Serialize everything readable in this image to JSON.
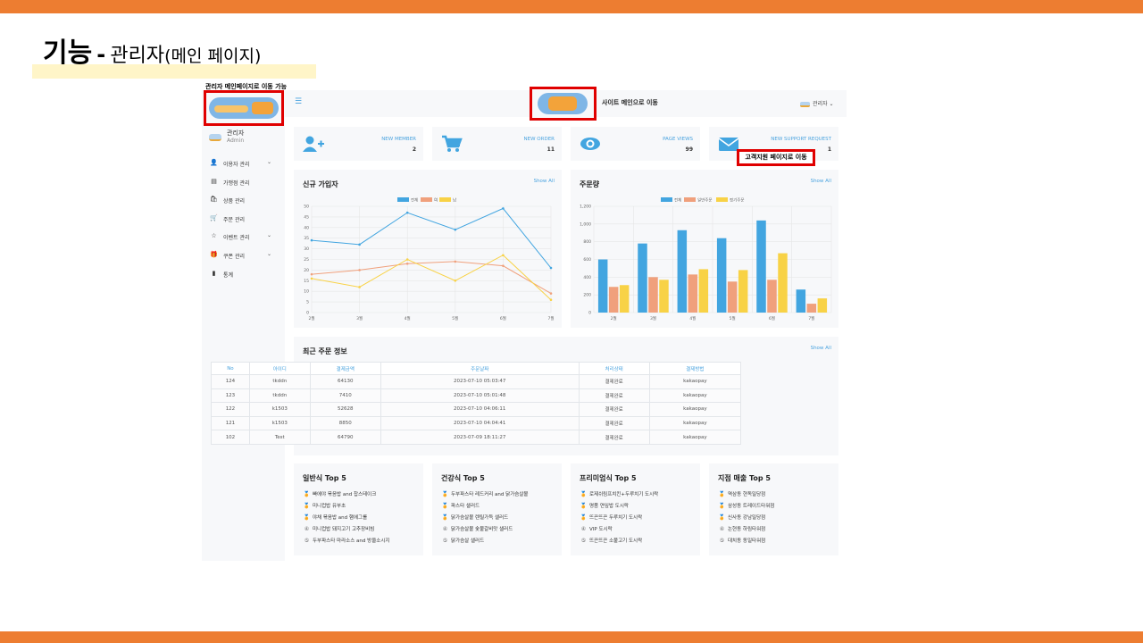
{
  "slide": {
    "title_main": "기능",
    "title_dash": "-",
    "title_sub": "관리자",
    "title_paren": "(메인 페이지)",
    "note": "관리자 메인페이지로 이동 가능",
    "support_label": "고객지원 페이지로 이동",
    "colors": {
      "accent_bar": "#ED7D31",
      "highlight": "#FFF5C8",
      "callout": "#E00000",
      "link": "#4AA3DF"
    }
  },
  "topbar": {
    "menu_icon": "hamburger-icon",
    "site_link": "사이트 메인으로 이동",
    "admin_label": "관리자"
  },
  "sidebar": {
    "profile_name": "관리자",
    "profile_role": "Admin",
    "items": [
      {
        "label": "이용자 관리",
        "icon": "user-icon",
        "glyph": "👤",
        "chevron": "⌄"
      },
      {
        "label": "가맹점 관리",
        "icon": "store-icon",
        "glyph": "▤",
        "chevron": ""
      },
      {
        "label": "상품 관리",
        "icon": "bag-icon",
        "glyph": "🛍",
        "chevron": ""
      },
      {
        "label": "주문 관리",
        "icon": "cart-icon",
        "glyph": "🛒",
        "chevron": ""
      },
      {
        "label": "이벤트 관리",
        "icon": "star-icon",
        "glyph": "☆",
        "chevron": "⌄"
      },
      {
        "label": "쿠폰 관리",
        "icon": "gift-icon",
        "glyph": "🎁",
        "chevron": "⌄"
      },
      {
        "label": "통계",
        "icon": "chart-icon",
        "glyph": "▮",
        "chevron": ""
      }
    ]
  },
  "stats": [
    {
      "label": "NEW MEMBER",
      "value": "2",
      "icon": "user-plus-icon"
    },
    {
      "label": "NEW ORDER",
      "value": "11",
      "icon": "cart-icon"
    },
    {
      "label": "PAGE VIEWS",
      "value": "99",
      "icon": "eye-icon"
    },
    {
      "label": "NEW SUPPORT REQUEST",
      "value": "1",
      "icon": "envelope-icon"
    }
  ],
  "signups_panel": {
    "title": "신규 가입자",
    "show_all": "Show All"
  },
  "orders_panel": {
    "title": "주문량",
    "show_all": "Show All"
  },
  "chart_data": [
    {
      "type": "line",
      "title": "신규 가입자",
      "categories": [
        "2월",
        "3월",
        "4월",
        "5월",
        "6월",
        "7월"
      ],
      "series": [
        {
          "name": "전체",
          "color": "#42A5E0",
          "values": [
            34,
            32,
            47,
            39,
            49,
            21
          ]
        },
        {
          "name": "여",
          "color": "#F0A07C",
          "values": [
            18,
            20,
            23,
            24,
            22,
            9
          ]
        },
        {
          "name": "남",
          "color": "#F8D246",
          "values": [
            16,
            12,
            25,
            15,
            27,
            6
          ]
        }
      ],
      "ylim": [
        0,
        50
      ],
      "yticks": [
        0,
        5,
        10,
        15,
        20,
        25,
        30,
        35,
        40,
        45,
        50
      ],
      "grid": true,
      "legend": "top"
    },
    {
      "type": "bar",
      "title": "주문량",
      "categories": [
        "2월",
        "3월",
        "4월",
        "5월",
        "6월",
        "7월"
      ],
      "series": [
        {
          "name": "전체",
          "color": "#42A5E0",
          "values": [
            600,
            780,
            930,
            840,
            1040,
            260
          ]
        },
        {
          "name": "일반주문",
          "color": "#F0A07C",
          "values": [
            290,
            400,
            430,
            350,
            370,
            100
          ]
        },
        {
          "name": "정기주문",
          "color": "#F8D246",
          "values": [
            310,
            370,
            490,
            480,
            670,
            160
          ]
        }
      ],
      "ylim": [
        0,
        1200
      ],
      "yticks": [
        0,
        200,
        400,
        600,
        800,
        1000,
        1200
      ],
      "ytick_labels": [
        "0",
        "200",
        "400",
        "600",
        "800",
        "1,000",
        "1,200"
      ],
      "grid": true,
      "legend": "top"
    }
  ],
  "recent_orders": {
    "title": "최근 주문 정보",
    "show_all": "Show All",
    "columns": [
      "No",
      "아이디",
      "결제금액",
      "주문날짜",
      "처리상태",
      "결제방법"
    ],
    "rows": [
      [
        "124",
        "tkddn",
        "64130",
        "2023-07-10 05:03:47",
        "결제완료",
        "kakaopay"
      ],
      [
        "123",
        "tkddn",
        "7410",
        "2023-07-10 05:01:48",
        "결제완료",
        "kakaopay"
      ],
      [
        "122",
        "k1503",
        "52628",
        "2023-07-10 04:06:11",
        "결제완료",
        "kakaopay"
      ],
      [
        "121",
        "k1503",
        "8850",
        "2023-07-10 04:04:41",
        "결제완료",
        "kakaopay"
      ],
      [
        "102",
        "Test",
        "64790",
        "2023-07-09 18:11:27",
        "결제완료",
        "kakaopay"
      ]
    ]
  },
  "top5": [
    {
      "title": "일반식 Top 5",
      "items": [
        "빠에야 볶음밥 and 찹스테이크",
        "미니컵밥 유부초",
        "야채 볶음밥 and 햄에그롤",
        "미니컵밥 돼지고기 고추장비빔",
        "두부파스타 마라소스 and 방울소시지"
      ]
    },
    {
      "title": "건강식 Top 5",
      "items": [
        "두부파스타 레드커리 and 닭가슴살볼",
        "파스타 샐러드",
        "닭가슴살볼 렌틸가득 샐러드",
        "닭가슴살볼 숯불갈비맛 샐러드",
        "닭가슴살 샐러드"
      ]
    },
    {
      "title": "프리미엄식 Top 5",
      "items": [
        "로제쉬림프치킨+두루치기 도시락",
        "명품 연잎밥 도시락",
        "뜨끈뜨끈 두루치기 도시락",
        "VIP 도시락",
        "뜨끈뜨끈 소불고기 도시락"
      ]
    },
    {
      "title": "지점 매출 Top 5",
      "items": [
        "역삼동 현독밀당점",
        "삼성동 트레이드타워점",
        "신사동 강남밀당점",
        "논현동 하림타워점",
        "대치동 동일타워점"
      ]
    }
  ],
  "rank_glyphs": [
    "🏅",
    "🏅",
    "🏅",
    "④",
    "⑤"
  ]
}
